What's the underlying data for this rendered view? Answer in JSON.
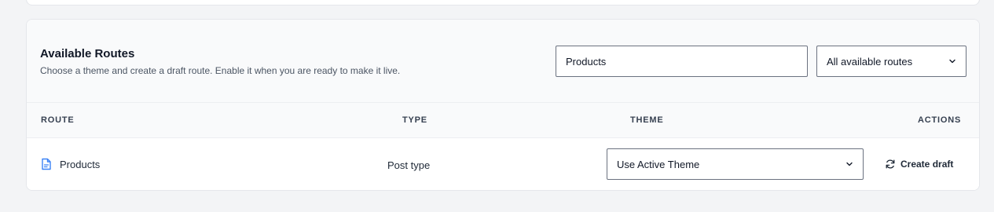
{
  "section": {
    "title": "Available Routes",
    "subtitle": "Choose a theme and create a draft route. Enable it when you are ready to make it live."
  },
  "search": {
    "value": "Products",
    "placeholder": ""
  },
  "filter": {
    "selected": "All available routes"
  },
  "table": {
    "columns": {
      "route": "ROUTE",
      "type": "TYPE",
      "theme": "THEME",
      "actions": "ACTIONS"
    },
    "rows": [
      {
        "route": "Products",
        "type": "Post type",
        "theme": "Use Active Theme",
        "action_label": "Create draft"
      }
    ]
  },
  "icons": {
    "route": "document-icon",
    "action": "refresh-icon",
    "dropdown": "chevron-down-icon"
  },
  "colors": {
    "accent": "#2563eb",
    "border": "#6b7280",
    "background": "#f3f4f6"
  }
}
